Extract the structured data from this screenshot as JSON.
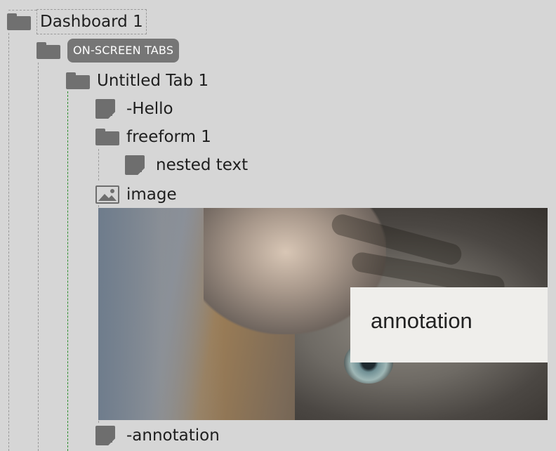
{
  "tree": {
    "dashboard": {
      "label": "Dashboard 1",
      "icon": "folder-icon"
    },
    "tabs_container": {
      "label": "ON-SCREEN TABS",
      "icon": "folder-icon"
    },
    "tab": {
      "label": "Untitled Tab 1",
      "icon": "folder-icon"
    },
    "items": [
      {
        "label": "-Hello",
        "icon": "text-icon"
      },
      {
        "label": "freeform 1",
        "icon": "folder-icon"
      },
      {
        "label": "nested text",
        "icon": "text-icon"
      },
      {
        "label": "image",
        "icon": "image-icon"
      },
      {
        "label": "-annotation",
        "icon": "text-icon"
      }
    ]
  },
  "preview": {
    "annotation_text": "annotation"
  },
  "colors": {
    "background": "#d6d6d6",
    "icon": "#707070",
    "pill": "#767676",
    "active_guide": "#2f8f2f",
    "annotation_bg": "#efeeeb"
  }
}
